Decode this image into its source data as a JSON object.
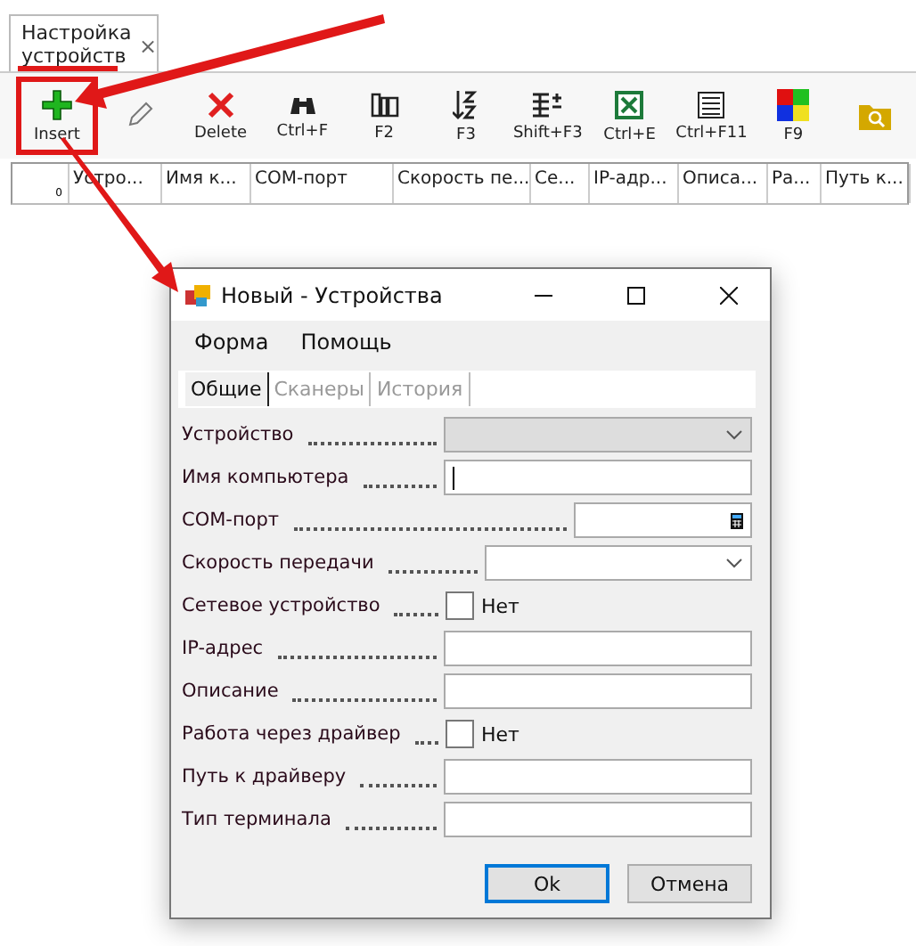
{
  "tab": {
    "label": "Настройка устройств",
    "close": "×",
    "selected": true
  },
  "toolbar": [
    {
      "label": "Insert",
      "highlighted": true
    },
    {
      "highlighted": false
    },
    {
      "label": "Delete",
      "highlighted": false
    },
    {
      "label": "Ctrl+F",
      "highlighted": false
    },
    {
      "label": "F2",
      "highlighted": false
    },
    {
      "label": "F3",
      "highlighted": false
    },
    {
      "label": "Shift+F3",
      "highlighted": false
    },
    {
      "label": "Ctrl+E",
      "highlighted": false
    },
    {
      "label": "Ctrl+F11",
      "highlighted": false
    },
    {
      "label": "F9",
      "highlighted": false
    },
    {
      "highlighted": false
    }
  ],
  "table": {
    "row_number": "0",
    "columns": [
      {
        "label": "Устро..."
      },
      {
        "label": "Имя к..."
      },
      {
        "label": "COM-порт"
      },
      {
        "label": "Скорость пе..."
      },
      {
        "label": "Се..."
      },
      {
        "label": "IP-адр..."
      },
      {
        "label": "Описа..."
      },
      {
        "label": "Ра..."
      },
      {
        "label": "Путь к..."
      }
    ]
  },
  "dialog": {
    "title": "Новый - Устройства",
    "menu": [
      "Форма",
      "Помощь"
    ],
    "tabs": [
      {
        "label": "Общие",
        "selected": true
      },
      {
        "label": "Сканеры",
        "selected": false
      },
      {
        "label": "История",
        "selected": false
      }
    ],
    "fields": [
      {
        "label": "Устройство",
        "kind": "combo",
        "disabled": true
      },
      {
        "label": "Имя компьютера",
        "kind": "text",
        "disabled": false
      },
      {
        "label": "COM-порт",
        "kind": "spin",
        "disabled": false
      },
      {
        "label": "Скорость передачи",
        "kind": "combo",
        "disabled": false
      },
      {
        "label": "Сетевое устройство",
        "kind": "check",
        "disabled": false,
        "checked": false,
        "text": "Нет"
      },
      {
        "label": "IP-адрес",
        "kind": "text",
        "disabled": false
      },
      {
        "label": "Описание",
        "kind": "text",
        "disabled": false
      },
      {
        "label": "Работа через драйвер",
        "kind": "check",
        "disabled": false,
        "checked": false,
        "text": "Нет"
      },
      {
        "label": "Путь к драйверу",
        "kind": "text",
        "disabled": false
      },
      {
        "label": "Тип терминала",
        "kind": "text",
        "disabled": false
      }
    ],
    "buttons": [
      {
        "label": "Ok",
        "default": true
      },
      {
        "label": "Отмена",
        "default": false
      }
    ]
  }
}
